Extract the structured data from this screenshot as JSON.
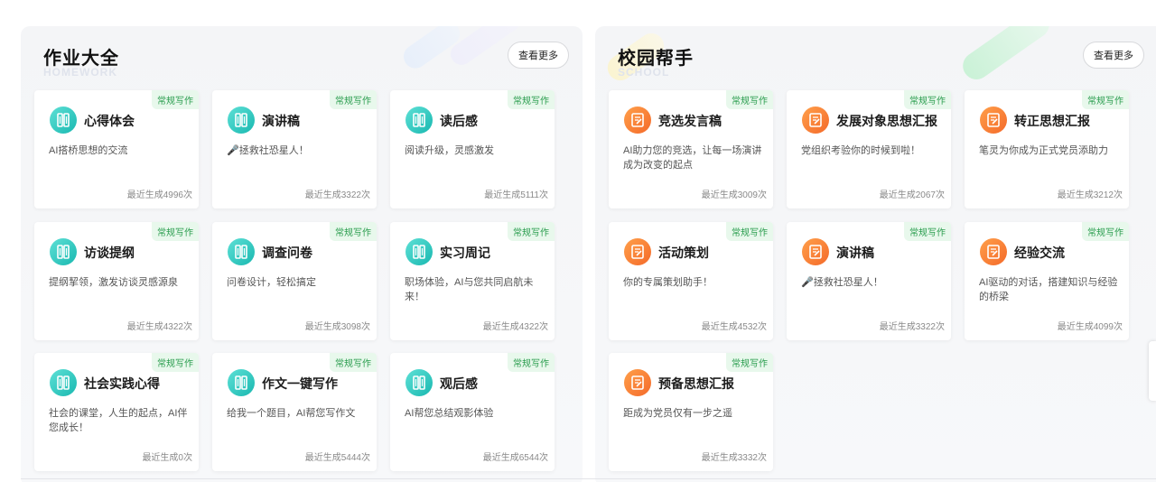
{
  "homework": {
    "title": "作业大全",
    "subtitle": "HOMEWORK",
    "more_label": "查看更多",
    "cards": [
      {
        "tag": "常规写作",
        "title": "心得体会",
        "desc": "AI搭桥思想的交流",
        "count": "最近生成4996次",
        "icon": "notebook-icon"
      },
      {
        "tag": "常规写作",
        "title": "演讲稿",
        "desc": "🎤拯救社恐星人！",
        "count": "最近生成3322次",
        "icon": "notebook-icon"
      },
      {
        "tag": "常规写作",
        "title": "读后感",
        "desc": "阅读升级，灵感激发",
        "count": "最近生成5111次",
        "icon": "notebook-icon"
      },
      {
        "tag": "常规写作",
        "title": "访谈提纲",
        "desc": "提纲挈领，激发访谈灵感源泉",
        "count": "最近生成4322次",
        "icon": "notebook-icon"
      },
      {
        "tag": "常规写作",
        "title": "调查问卷",
        "desc": "问卷设计，轻松搞定",
        "count": "最近生成3098次",
        "icon": "notebook-icon"
      },
      {
        "tag": "常规写作",
        "title": "实习周记",
        "desc": "职场体验，AI与您共同启航未来！",
        "count": "最近生成4322次",
        "icon": "notebook-icon"
      },
      {
        "tag": "常规写作",
        "title": "社会实践心得",
        "desc": "社会的课堂，人生的起点，AI伴您成长！",
        "count": "最近生成0次",
        "icon": "notebook-icon"
      },
      {
        "tag": "常规写作",
        "title": "作文一键写作",
        "desc": "给我一个题目，AI帮您写作文",
        "count": "最近生成5444次",
        "icon": "notebook-icon"
      },
      {
        "tag": "常规写作",
        "title": "观后感",
        "desc": "AI帮您总结观影体验",
        "count": "最近生成6544次",
        "icon": "notebook-icon"
      }
    ]
  },
  "school": {
    "title": "校园帮手",
    "subtitle": "SCHOOL",
    "more_label": "查看更多",
    "cards": [
      {
        "tag": "常规写作",
        "title": "竞选发言稿",
        "desc": "AI助力您的竞选，让每一场演讲成为改变的起点",
        "count": "最近生成3009次",
        "icon": "document-pen-icon"
      },
      {
        "tag": "常规写作",
        "title": "发展对象思想汇报",
        "desc": "党组织考验你的时候到啦！",
        "count": "最近生成2067次",
        "icon": "document-pen-icon"
      },
      {
        "tag": "常规写作",
        "title": "转正思想汇报",
        "desc": "笔灵为你成为正式党员添助力",
        "count": "最近生成3212次",
        "icon": "document-pen-icon"
      },
      {
        "tag": "常规写作",
        "title": "活动策划",
        "desc": "你的专属策划助手！",
        "count": "最近生成4532次",
        "icon": "document-pen-icon"
      },
      {
        "tag": "常规写作",
        "title": "演讲稿",
        "desc": "🎤拯救社恐星人！",
        "count": "最近生成3322次",
        "icon": "document-pen-icon"
      },
      {
        "tag": "常规写作",
        "title": "经验交流",
        "desc": "AI驱动的对话，搭建知识与经验的桥梁",
        "count": "最近生成4099次",
        "icon": "document-pen-icon"
      },
      {
        "tag": "常规写作",
        "title": "预备思想汇报",
        "desc": "距成为党员仅有一步之遥",
        "count": "最近生成3332次",
        "icon": "document-pen-icon"
      }
    ]
  },
  "colors": {
    "tag_bg": "#e8f8ec",
    "tag_text": "#2a9d4e",
    "homework_icon": "#19b8b0",
    "school_icon": "#f46a2a"
  }
}
